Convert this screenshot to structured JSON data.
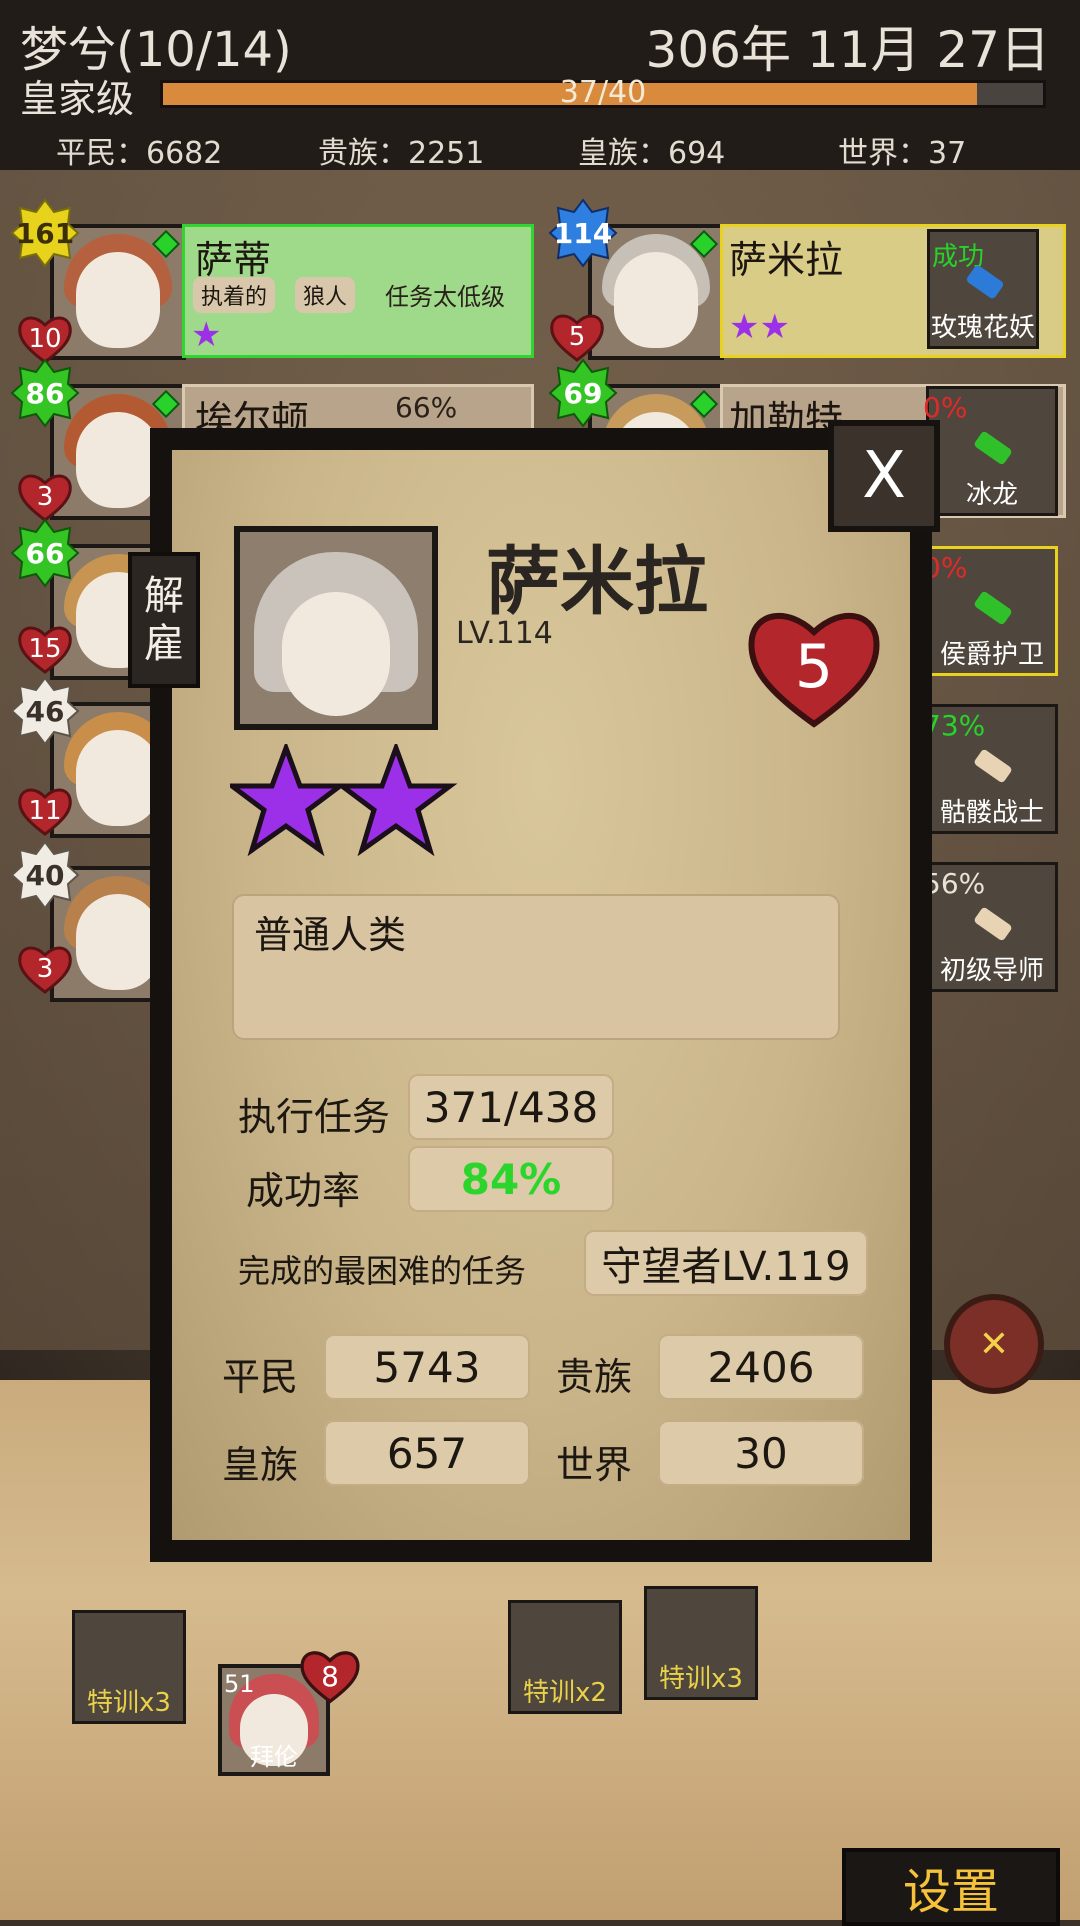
{
  "header": {
    "guild_name": "梦兮(10/14)",
    "date": "306年 11月 27日",
    "rank": "皇家级",
    "xp_text": "37/40",
    "xp_fraction": 0.925,
    "stats": [
      {
        "label": "平民：6682"
      },
      {
        "label": "贵族：2251"
      },
      {
        "label": "皇族：694"
      },
      {
        "label": "世界：37"
      }
    ]
  },
  "roster_left": [
    {
      "level": "161",
      "hearts": "10",
      "name": "萨蒂",
      "tags": [
        "执着的",
        "狼人"
      ],
      "note": "任务太低级",
      "stars": 1
    },
    {
      "level": "86",
      "hearts": "3",
      "name": "埃尔顿",
      "pct": "66%"
    },
    {
      "level": "66",
      "hearts": "15"
    },
    {
      "level": "46",
      "hearts": "11"
    },
    {
      "level": "40",
      "hearts": "3"
    }
  ],
  "roster_right": [
    {
      "level": "114",
      "hearts": "5",
      "name": "萨米拉",
      "stars": 2,
      "quest_status": "成功",
      "quest_name": "玫瑰花妖"
    },
    {
      "level": "69",
      "name": "加勒特",
      "quest_pct": "0%",
      "quest_name": "冰龙"
    }
  ],
  "right_quests": [
    {
      "pct": "0%",
      "name": "侯爵护卫"
    },
    {
      "pct": "73%",
      "name": "骷髅战士"
    },
    {
      "pct": "56%",
      "name": "初级导师"
    }
  ],
  "modal": {
    "close_label": "X",
    "fire_label": "解雇",
    "name": "萨米拉",
    "level": "LV.114",
    "hearts": "5",
    "stars": 2,
    "description": "普通人类",
    "missions_label": "执行任务",
    "missions_value": "371/438",
    "success_label": "成功率",
    "success_value": "84%",
    "hardest_label": "完成的最困难的任务",
    "hardest_value": "守望者LV.119",
    "tiers": [
      {
        "label": "平民",
        "value": "5743"
      },
      {
        "label": "贵族",
        "value": "2406"
      },
      {
        "label": "皇族",
        "value": "657"
      },
      {
        "label": "世界",
        "value": "30"
      }
    ]
  },
  "bottom": {
    "training": [
      "特训x3",
      "特训x2",
      "特训x3"
    ],
    "recruit": {
      "level": "51",
      "hearts": "8",
      "name": "拜伦"
    },
    "settings_label": "设置"
  },
  "colors": {
    "accent_orange": "#d98a3c",
    "success_green": "#28d22a",
    "fail_red": "#e02a2a",
    "star_purple": "#9b30e8",
    "settings_gold": "#f5c23a"
  }
}
